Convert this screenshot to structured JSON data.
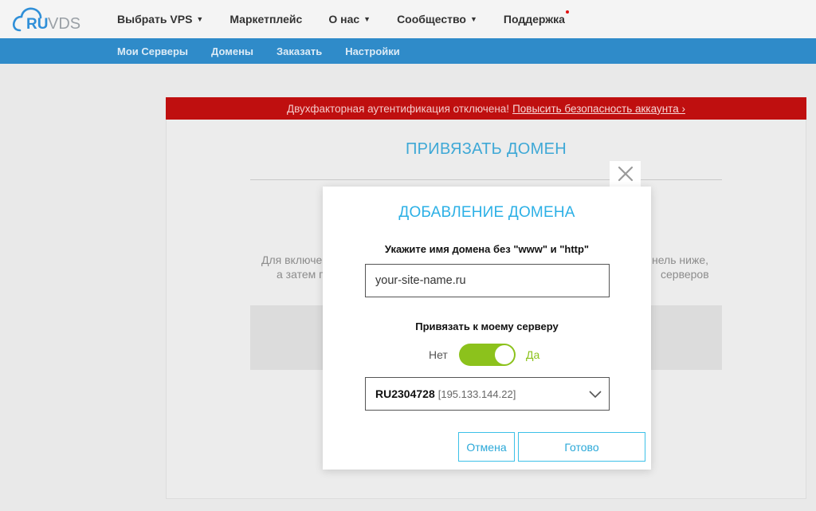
{
  "header": {
    "logo": {
      "ru": "RU",
      "vds": "VDS",
      "icon": "cloud-icon"
    },
    "nav": [
      {
        "label": "Выбрать VPS",
        "caret": true
      },
      {
        "label": "Маркетплейс",
        "caret": false
      },
      {
        "label": "О нас",
        "caret": true
      },
      {
        "label": "Сообщество",
        "caret": true
      },
      {
        "label": "Поддержка",
        "caret": false,
        "notification_dot": true
      }
    ]
  },
  "subnav": [
    "Мои Серверы",
    "Домены",
    "Заказать",
    "Настройки"
  ],
  "alert": {
    "text": "Двухфакторная аутентификация отключена!",
    "link": "Повысить безопасность аккаунта ›"
  },
  "page": {
    "title": "ПРИВЯЗАТЬ ДОМЕН",
    "bg_text_left_1": "Для включе",
    "bg_text_left_2": "а затем п",
    "bg_text_right_1": "нель ниже,",
    "bg_text_right_2": "серверов"
  },
  "modal": {
    "title": "ДОБАВЛЕНИЕ ДОМЕНА",
    "domain_label": "Укажите имя домена без \"www\" и \"http\"",
    "domain_value": "your-site-name.ru",
    "bind_label": "Привязать к моему серверу",
    "toggle_off_label": "Нет",
    "toggle_on_label": "Да",
    "toggle_on": true,
    "server_id": "RU2304728",
    "server_ip": "[195.133.144.22]",
    "cancel_label": "Отмена",
    "done_label": "Готово"
  },
  "colors": {
    "brand_blue": "#2f8bc9",
    "alert_red": "#bf0f0f",
    "accent_cyan": "#2cb0e6",
    "toggle_green": "#8cc21c"
  }
}
